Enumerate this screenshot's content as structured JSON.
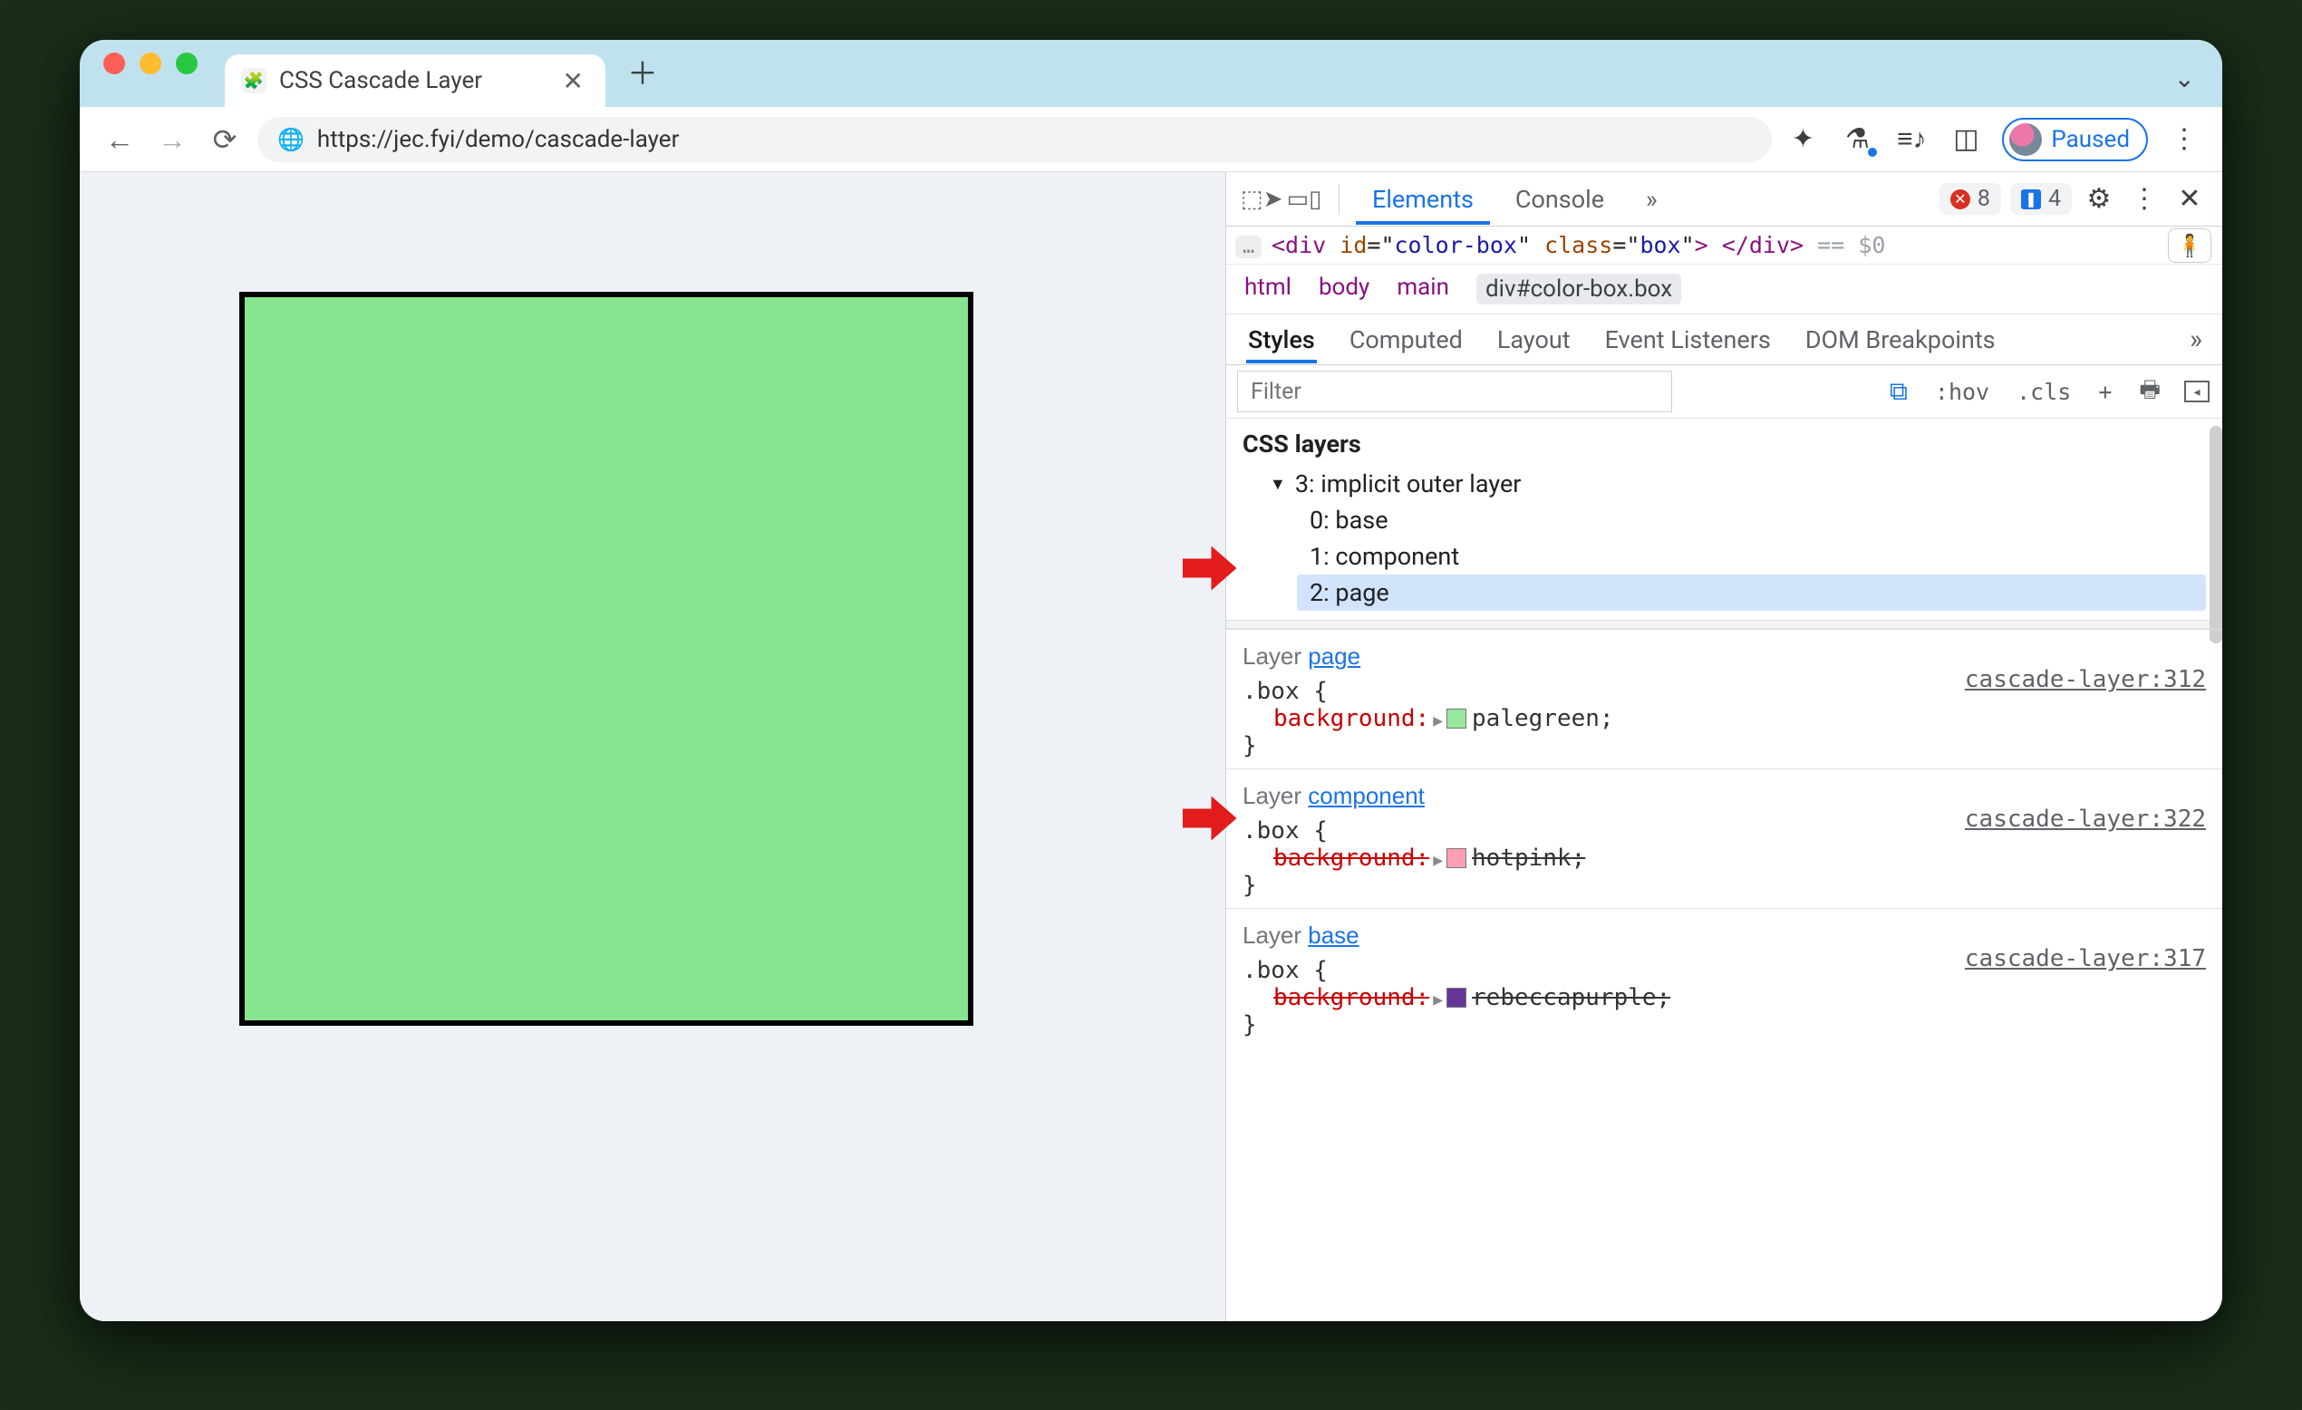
{
  "tab": {
    "title": "CSS Cascade Layer",
    "favicon": "🧩"
  },
  "address": {
    "url": "https://jec.fyi/demo/cascade-layer"
  },
  "paused_label": "Paused",
  "devtools": {
    "main_tabs": {
      "elements": "Elements",
      "console": "Console"
    },
    "counts": {
      "errors": "8",
      "issues": "4"
    },
    "element_html": {
      "open_tag": "<div",
      "id_attr": "id",
      "id_val": "color-box",
      "class_attr": "class",
      "class_val": "box",
      "close": "> </div>",
      "eq0": "== $0"
    },
    "crumbs": [
      "html",
      "body",
      "main",
      "div#color-box.box"
    ],
    "styles_tabs": [
      "Styles",
      "Computed",
      "Layout",
      "Event Listeners",
      "DOM Breakpoints"
    ],
    "filter_placeholder": "Filter",
    "toolbar_labels": {
      "hov": ":hov",
      "cls": ".cls",
      "plus": "+"
    },
    "css_layers": {
      "title": "CSS layers",
      "parent": "3: implicit outer layer",
      "children": [
        "0: base",
        "1: component",
        "2: page"
      ],
      "selected_index": 2
    },
    "rules": [
      {
        "layer_prefix": "Layer ",
        "layer_name": "page",
        "selector": ".box",
        "source": "cascade-layer:312",
        "prop": "background",
        "color": "#98e89f",
        "value": "palegreen",
        "struck": false
      },
      {
        "layer_prefix": "Layer ",
        "layer_name": "component",
        "selector": ".box",
        "source": "cascade-layer:322",
        "prop": "background",
        "color": "#ff9fb4",
        "value": "hotpink",
        "struck": true
      },
      {
        "layer_prefix": "Layer ",
        "layer_name": "base",
        "selector": ".box",
        "source": "cascade-layer:317",
        "prop": "background",
        "color": "#663399",
        "value": "rebeccapurple",
        "struck": true
      }
    ]
  }
}
